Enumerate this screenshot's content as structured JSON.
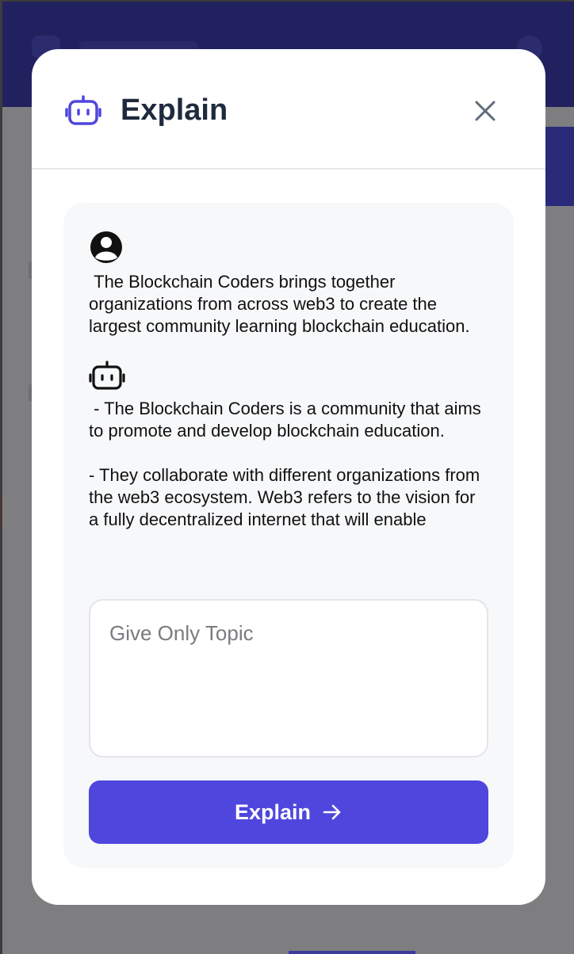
{
  "colors": {
    "accent": "#4f46dd",
    "title": "#1f2a3d",
    "overlay_header": "#22215f",
    "panel_bg": "#f7f8fa"
  },
  "modal": {
    "title": "Explain",
    "header_icon": "robot-icon",
    "close_icon": "close-icon"
  },
  "chat": {
    "messages": [
      {
        "role": "user",
        "avatar_icon": "user-circle-icon",
        "text": " The Blockchain Coders brings together organizations from across web3 to create the largest community learning blockchain education."
      },
      {
        "role": "assistant",
        "avatar_icon": "robot-icon",
        "text": " - The Blockchain Coders is a community that aims to promote and develop blockchain education.\n\n- They collaborate with different organizations from the web3 ecosystem. Web3 refers to the vision for a fully decentralized internet that will enable"
      }
    ]
  },
  "input": {
    "placeholder": "Give Only Topic",
    "value": ""
  },
  "submit": {
    "label": "Explain",
    "icon": "arrow-right-icon"
  }
}
